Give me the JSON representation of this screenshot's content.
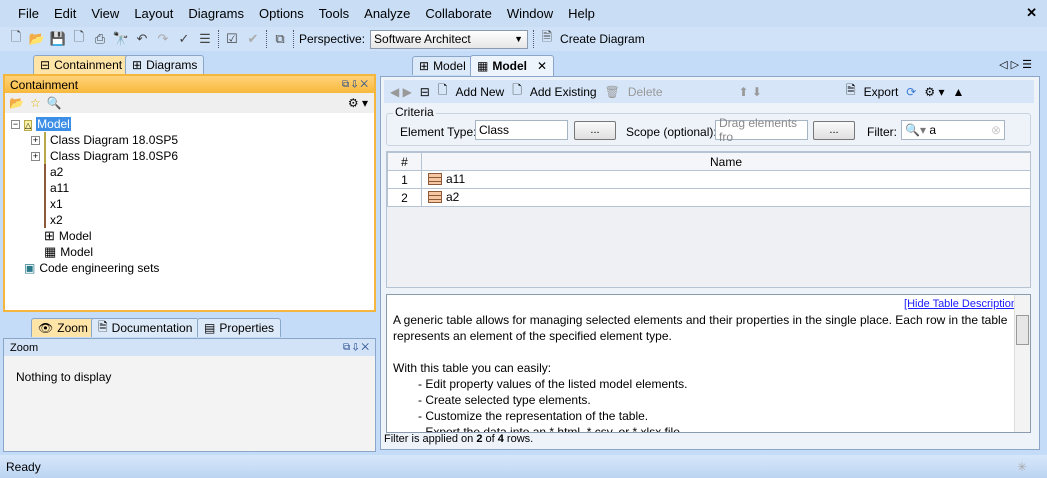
{
  "menu": [
    "File",
    "Edit",
    "View",
    "Layout",
    "Diagrams",
    "Options",
    "Tools",
    "Analyze",
    "Collaborate",
    "Window",
    "Help"
  ],
  "toolbar": {
    "perspective_label": "Perspective:",
    "perspective_value": "Software Architect",
    "create_diagram": "Create Diagram"
  },
  "left_tabs": [
    "Containment",
    "Diagrams"
  ],
  "containment": {
    "title": "Containment",
    "tree": [
      {
        "label": "Model",
        "level": 0,
        "icon": "package",
        "selected": true,
        "expander": "-"
      },
      {
        "label": "Class Diagram 18.0SP5",
        "level": 1,
        "icon": "folder",
        "expander": "+"
      },
      {
        "label": "Class Diagram 18.0SP6",
        "level": 1,
        "icon": "folder",
        "expander": "+"
      },
      {
        "label": "a2",
        "level": 1,
        "icon": "class"
      },
      {
        "label": "a11",
        "level": 1,
        "icon": "class"
      },
      {
        "label": "x1",
        "level": 1,
        "icon": "class"
      },
      {
        "label": "x2",
        "level": 1,
        "icon": "class"
      },
      {
        "label": "Model",
        "level": 1,
        "icon": "diagram"
      },
      {
        "label": "Model",
        "level": 1,
        "icon": "table"
      },
      {
        "label": "Code engineering sets",
        "level": 0,
        "icon": "code-sets"
      }
    ]
  },
  "bottom_tabs": [
    "Zoom",
    "Documentation",
    "Properties"
  ],
  "zoom": {
    "title": "Zoom",
    "empty": "Nothing to display"
  },
  "editor_tabs": [
    "Model",
    "Model"
  ],
  "table_toolbar": {
    "add_new": "Add New",
    "add_existing": "Add Existing",
    "delete": "Delete",
    "export": "Export"
  },
  "criteria": {
    "title": "Criteria",
    "element_type_label": "Element Type:",
    "element_type_value": "Class",
    "browse": "...",
    "scope_label": "Scope (optional):",
    "scope_placeholder": "Drag elements fro",
    "filter_label": "Filter:",
    "filter_value": "a"
  },
  "table": {
    "headers": [
      "#",
      "Name"
    ],
    "rows": [
      {
        "num": "1",
        "name": "a11"
      },
      {
        "num": "2",
        "name": "a2"
      }
    ]
  },
  "description": {
    "hide_link": "[Hide Table Description]",
    "p1": "A generic table allows for managing selected elements and their properties in the single place. Each row in the table represents an element of the specified element type.",
    "p2": "With this table you can easily:",
    "items": [
      "- Edit property values of the listed model elements.",
      "- Create selected type elements.",
      "- Customize the representation of the table.",
      "- Export the data into an *.html, *.csv, or *.xlsx file."
    ]
  },
  "filter_status": {
    "prefix": "Filter is applied on ",
    "shown": "2",
    "mid": " of ",
    "total": "4",
    "suffix": " rows."
  },
  "status": "Ready"
}
